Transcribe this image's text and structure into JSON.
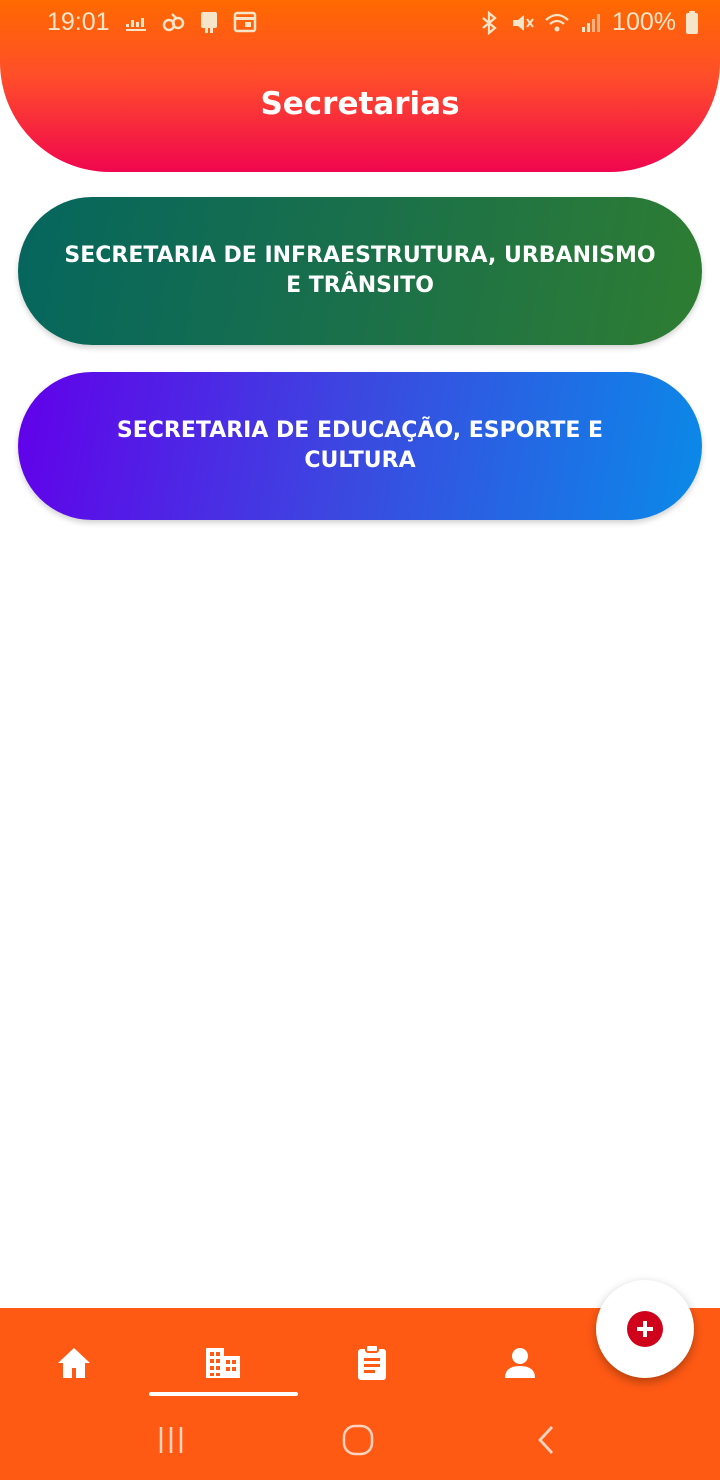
{
  "status_bar": {
    "time": "19:01",
    "battery": "100%",
    "left_icons": [
      "equalizer-icon",
      "notification-icon",
      "app-icon",
      "calendar-icon"
    ],
    "right_icons": [
      "bluetooth-icon",
      "mute-icon",
      "wifi-icon",
      "signal-icon",
      "battery-icon"
    ]
  },
  "header": {
    "title": "Secretarias"
  },
  "secretarias": [
    {
      "label": "SECRETARIA DE INFRAESTRUTURA, URBANISMO E TRÂNSITO",
      "color_start": "#05665e",
      "color_end": "#2e7d32"
    },
    {
      "label": "SECRETARIA DE EDUCAÇÃO, ESPORTE E CULTURA",
      "color_start": "#6200ea",
      "color_end": "#0a8ae8"
    }
  ],
  "bottom_nav": {
    "items": [
      {
        "icon": "home-icon"
      },
      {
        "icon": "building-icon",
        "active": true
      },
      {
        "icon": "clipboard-icon"
      },
      {
        "icon": "person-icon"
      }
    ]
  },
  "fab": {
    "icon": "plus-icon"
  },
  "system_nav": [
    "recents-icon",
    "home-circle-icon",
    "back-icon"
  ],
  "colors": {
    "header_top": "#ff6a00",
    "header_bottom": "#f0064e",
    "nav_bg": "#ff5a14",
    "fab_accent": "#d0021b"
  }
}
